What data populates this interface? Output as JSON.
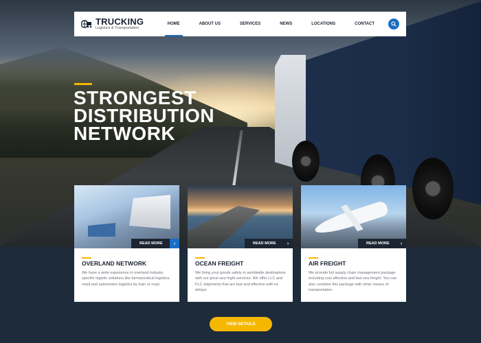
{
  "brand": {
    "title": "TRUCKING",
    "subtitle": "Logistics & Transportation"
  },
  "nav": {
    "items": [
      {
        "label": "HOME",
        "active": true
      },
      {
        "label": "ABOUT US",
        "active": false
      },
      {
        "label": "SERVICES",
        "active": false
      },
      {
        "label": "NEWS",
        "active": false
      },
      {
        "label": "LOCATIONS",
        "active": false
      },
      {
        "label": "CONTACT",
        "active": false
      }
    ],
    "search_icon": "search-icon"
  },
  "hero": {
    "title_lines": [
      "STRONGEST",
      "DISTRIBUTION",
      "NETWORK"
    ]
  },
  "cards": [
    {
      "read_more": "READ MORE",
      "title": "OVERLAND NETWORK",
      "text": "We have a wide experience in overland industry specific logistic solutions like farmaceutical logistics, retail and automotive logistics by train or road."
    },
    {
      "read_more": "READ MORE",
      "title": "OCEAN FREIGHT",
      "text": "We bring your goods safely to worldwide destinations with our great sea fright services. We offer LLC and FLC shipments that are fast and effective with no delays."
    },
    {
      "read_more": "READ MORE",
      "title": "AIR FREIGHT",
      "text": "We provide full supply chain management package including cost effective and fast sea freight. You can also combine this package with other means of transportation."
    }
  ],
  "cta": {
    "label": "VIEW DETAILS"
  },
  "colors": {
    "accent_yellow": "#f5b800",
    "accent_blue": "#1a6dc4",
    "dark_navy": "#1d2b3b"
  }
}
